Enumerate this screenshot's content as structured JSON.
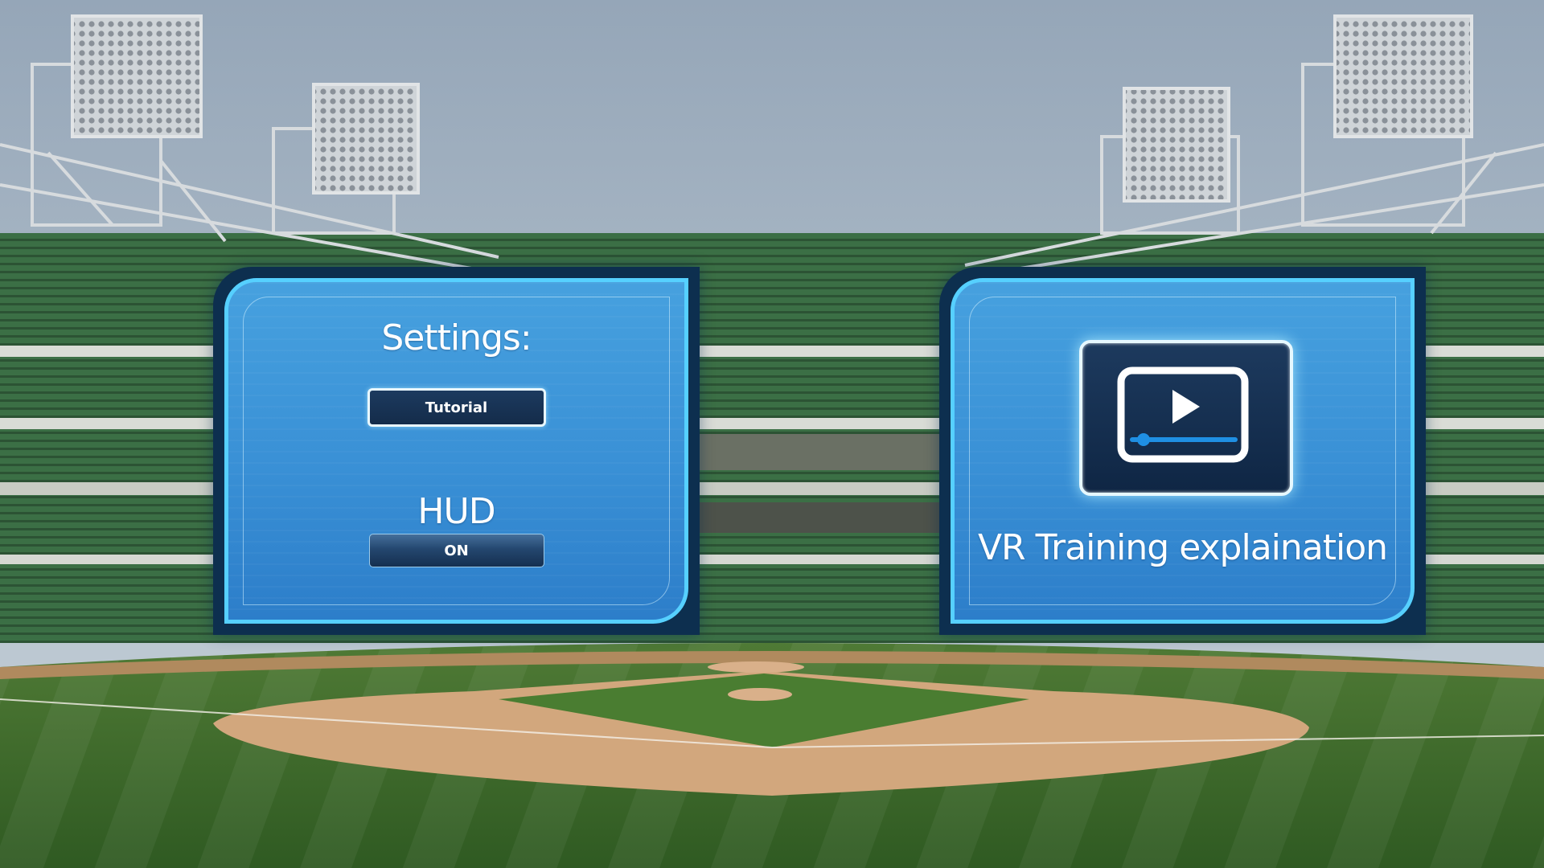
{
  "settings_panel": {
    "title": "Settings:",
    "tutorial_button": "Tutorial",
    "hud_label": "HUD",
    "hud_toggle": "ON"
  },
  "video_panel": {
    "caption": "VR Training explaination",
    "icon": "play-video-icon"
  },
  "colors": {
    "panel_fill": "#3f9ae0",
    "panel_frame": "#0d2f4f",
    "panel_border": "#56d0ff",
    "button_dark": "#142c4a",
    "accent_blue": "#1f8fe3"
  }
}
